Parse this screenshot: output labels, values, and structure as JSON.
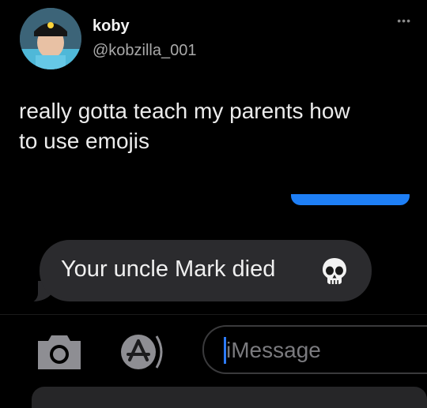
{
  "tweet": {
    "display_name": "koby",
    "handle": "@kobzilla_001",
    "more_icon": "more-dots-icon",
    "text_line1": "really gotta teach my parents how",
    "text_line2": "to use emojis"
  },
  "conversation": {
    "received_message": "Your uncle Mark died",
    "received_emoji": "skull-icon"
  },
  "compose_bar": {
    "camera_icon": "camera-icon",
    "apps_icon": "app-store-icon",
    "placeholder": "iMessage"
  },
  "colors": {
    "background": "#000000",
    "sent_bubble": "#1e7ff6",
    "received_bubble": "#2b2b2e",
    "caret": "#2d7bf6"
  }
}
